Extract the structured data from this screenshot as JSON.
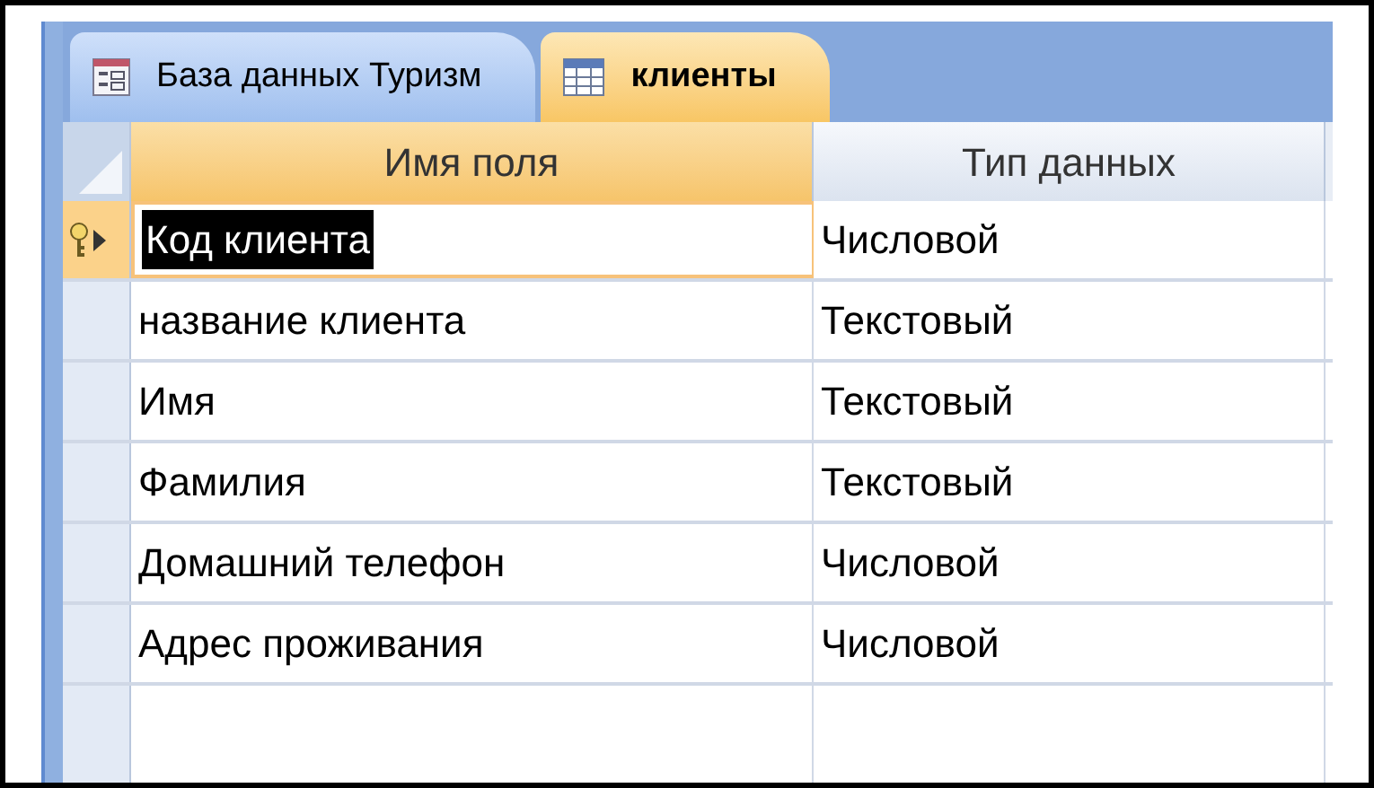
{
  "tabs": [
    {
      "label": "База данных Туризм",
      "kind": "form",
      "selected": false
    },
    {
      "label": "клиенты",
      "kind": "table",
      "selected": true
    }
  ],
  "table": {
    "columns": [
      "Имя поля",
      "Тип данных"
    ],
    "rows": [
      {
        "field_name": "Код клиента",
        "data_type": "Числовой",
        "primary_key": true,
        "selected": true
      },
      {
        "field_name": "название клиента",
        "data_type": "Текстовый",
        "primary_key": false,
        "selected": false
      },
      {
        "field_name": "Имя",
        "data_type": "Текстовый",
        "primary_key": false,
        "selected": false
      },
      {
        "field_name": "Фамилия",
        "data_type": "Текстовый",
        "primary_key": false,
        "selected": false
      },
      {
        "field_name": "Домашний телефон",
        "data_type": "Числовой",
        "primary_key": false,
        "selected": false
      },
      {
        "field_name": "Адрес проживания",
        "data_type": "Числовой",
        "primary_key": false,
        "selected": false
      }
    ]
  }
}
